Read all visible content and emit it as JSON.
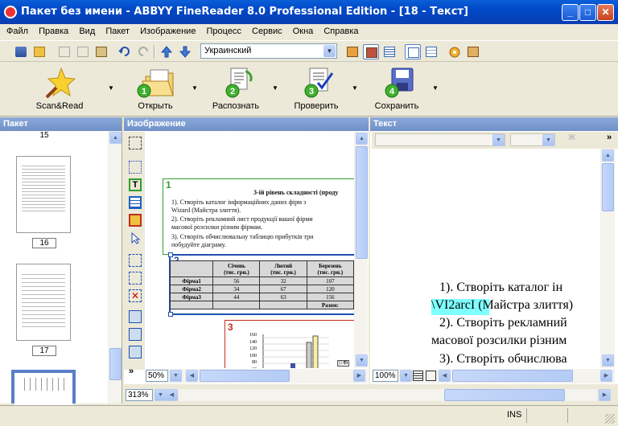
{
  "window": {
    "title": "Пакет без имени - ABBYY FineReader 8.0 Professional Edition - [18 - Текст]",
    "minimize": "_",
    "maximize": "□",
    "close": "✕"
  },
  "menu": [
    "Файл",
    "Правка",
    "Вид",
    "Пакет",
    "Изображение",
    "Процесс",
    "Сервис",
    "Окна",
    "Справка"
  ],
  "language_select": {
    "value": "Украинский"
  },
  "big_toolbar": {
    "scan": "Scan&Read",
    "open": "Открыть",
    "recognize": "Распознать",
    "check": "Проверить",
    "save": "Сохранить",
    "step_numbers": [
      "1",
      "2",
      "3",
      "4"
    ]
  },
  "panels": {
    "packet": "Пакет",
    "image": "Изображение",
    "text": "Текст"
  },
  "packet_pages": [
    "15",
    "16",
    "17"
  ],
  "image_view": {
    "block_numbers": [
      "1",
      "2",
      "3"
    ],
    "heading": "3-ій рівень складності (проду",
    "lines": [
      "1).   Створіть каталог інформаційних даних   фірм   з",
      "Wizard (Майстра злиття).",
      "2).   Створіть рекламний лист  продукції вашої фірми",
      "масової розсилки  різним фірмам.",
      "3).   Створіть обчислювальну таблицю прибутків три",
      "побудуйте діаграму."
    ],
    "table": {
      "headers": [
        "",
        "Січень\n(тис. грн.)",
        "Лютий\n(тис. грн.)",
        "Березень\n(тис. грн.)"
      ],
      "rows": [
        [
          "Фірма1",
          "56",
          "32",
          "107"
        ],
        [
          "Фірма2",
          "34",
          "67",
          "120"
        ],
        [
          "Фірма3",
          "44",
          "63",
          "156"
        ],
        [
          "",
          "",
          "",
          "Разом:"
        ]
      ]
    },
    "chart_ticks": [
      "160",
      "140",
      "120",
      "100",
      "80",
      "60"
    ],
    "legend_snippet": "□ Фі",
    "zoom": "50%"
  },
  "text_view": {
    "lines": [
      "1).  Створіть  каталог  ін",
      "\\VI2arcI (Майстра злиття)",
      "2).  Створіть  рекламний",
      "масової розсилки різним",
      "3).  Створіть  обчислюва"
    ],
    "highlight": "\\VI2arcI",
    "zoom": "100%"
  },
  "bottom_zoom": "313%",
  "status": {
    "ins": "INS"
  },
  "colors": {
    "accent": "#0a5fd8",
    "panel_head": "#7b9bd0"
  }
}
